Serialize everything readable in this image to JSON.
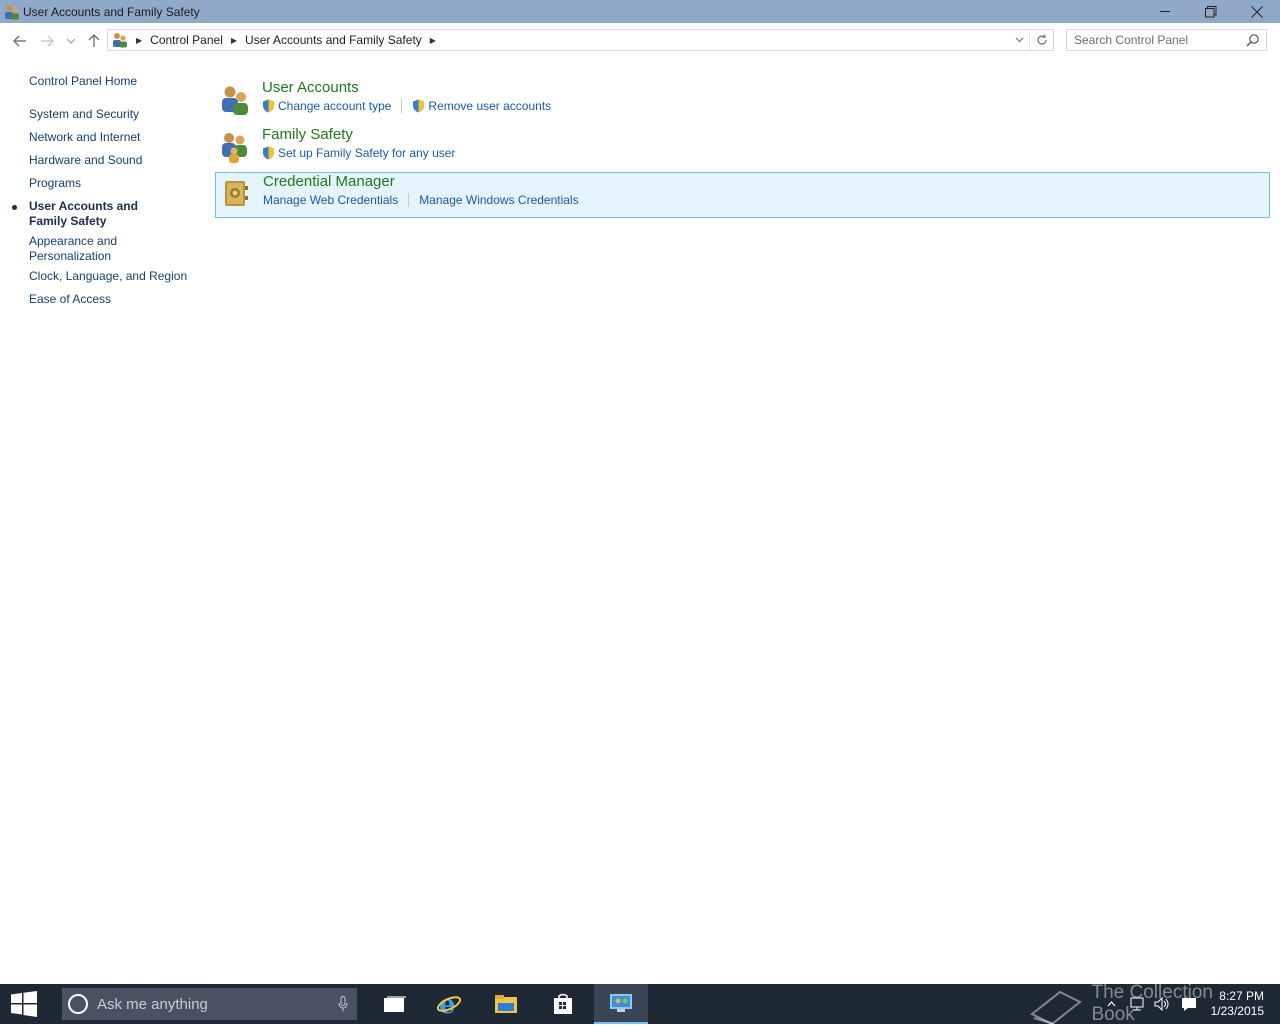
{
  "window": {
    "title": "User Accounts and Family Safety",
    "controls": [
      "minimize-icon",
      "restore-icon",
      "close-icon"
    ]
  },
  "nav": {
    "breadcrumb": [
      "Control Panel",
      "User Accounts and Family Safety"
    ],
    "search_placeholder": "Search Control Panel"
  },
  "sidebar": {
    "home": "Control Panel Home",
    "items": [
      {
        "label": "System and Security"
      },
      {
        "label": "Network and Internet"
      },
      {
        "label": "Hardware and Sound"
      },
      {
        "label": "Programs"
      },
      {
        "label": "User Accounts and Family Safety",
        "active": true
      },
      {
        "label": "Appearance and Personalization"
      },
      {
        "label": "Clock, Language, and Region"
      },
      {
        "label": "Ease of Access"
      }
    ]
  },
  "categories": [
    {
      "title": "User Accounts",
      "icon": "users-icon",
      "links": [
        "Change account type",
        "Remove user accounts"
      ]
    },
    {
      "title": "Family Safety",
      "icon": "family-icon",
      "links": [
        "Set up Family Safety for any user"
      ]
    },
    {
      "title": "Credential Manager",
      "icon": "vault-icon",
      "links": [
        "Manage Web Credentials",
        "Manage Windows Credentials"
      ],
      "highlighted": true
    }
  ],
  "taskbar": {
    "search_placeholder": "Ask me anything",
    "apps": [
      "task-view-icon",
      "internet-explorer-icon",
      "file-explorer-icon",
      "store-icon",
      "control-panel-icon"
    ],
    "time": "8:27 PM",
    "date": "1/23/2015",
    "watermark": "The Collection Book"
  },
  "colors": {
    "titlebar": "#91a9c9",
    "link": "#1c5aa5",
    "category_title": "#1c7a1c",
    "highlight_bg": "#e5f3fb",
    "highlight_border": "#70c0e7",
    "taskbar": "#1f2936"
  }
}
